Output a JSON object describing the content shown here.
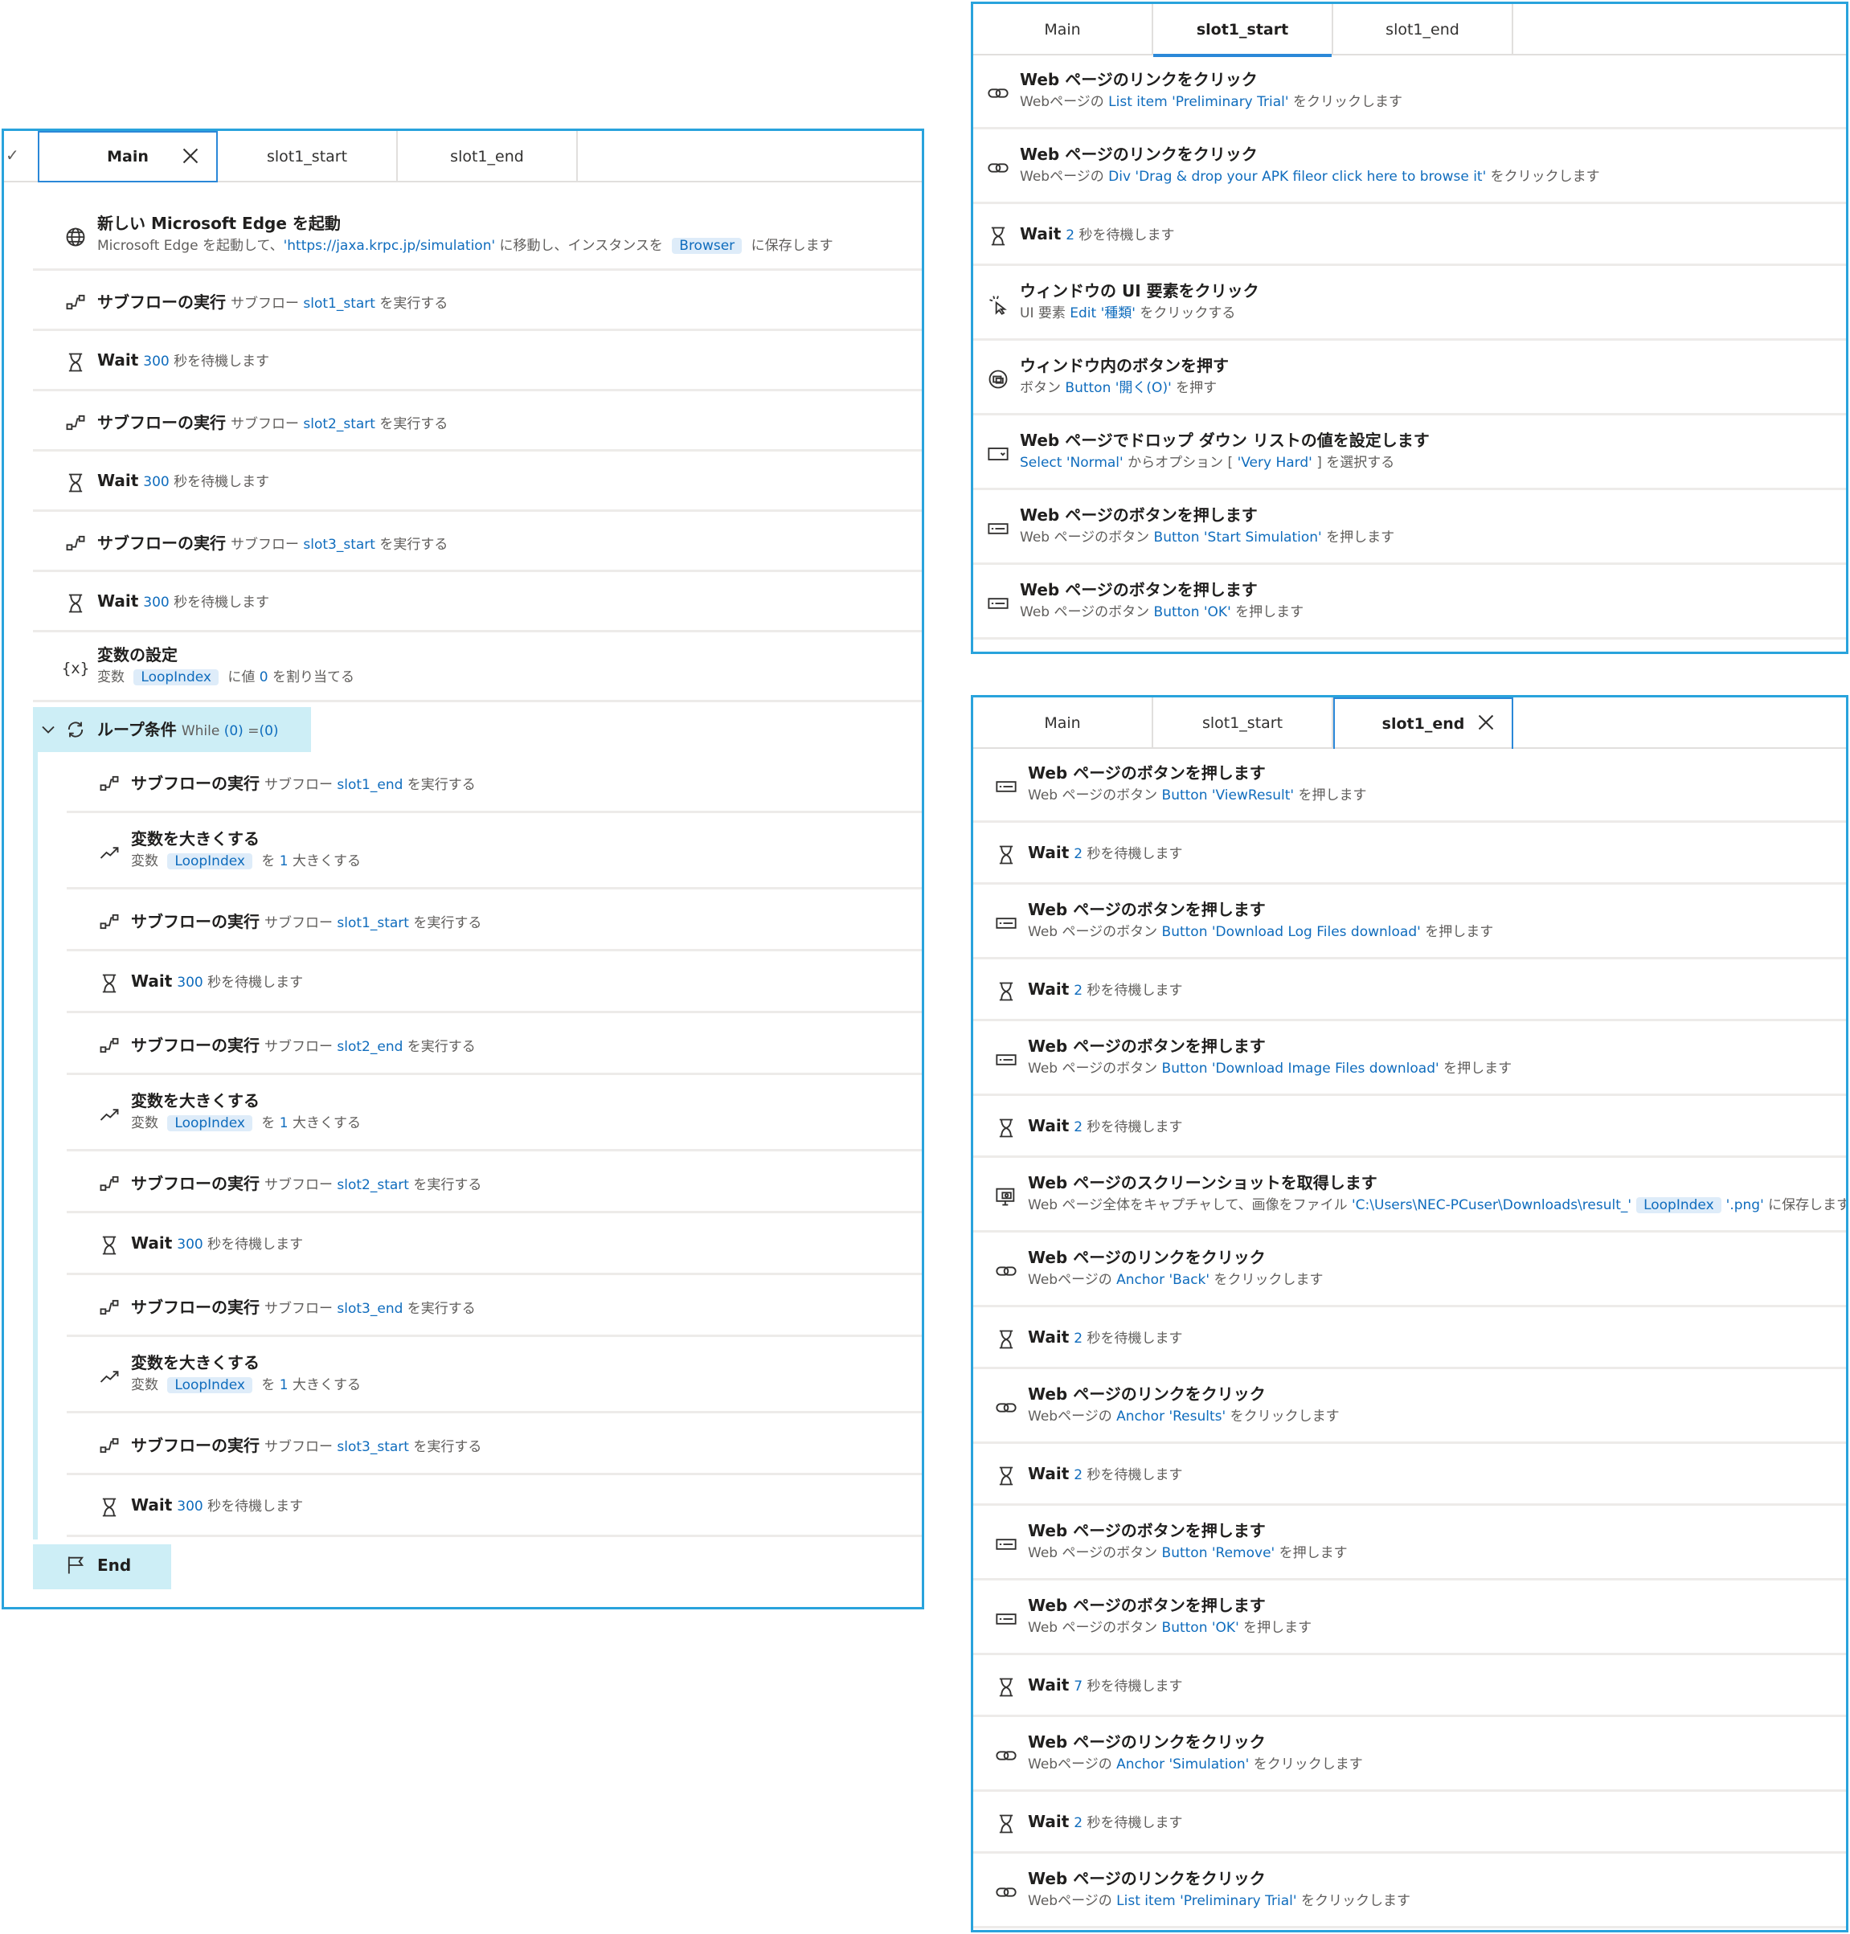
{
  "main_panel": {
    "tabs": [
      {
        "label": "Main"
      },
      {
        "label": "slot1_start"
      },
      {
        "label": "slot1_end"
      }
    ],
    "steps": [
      {
        "icon": "globe-icon",
        "title": "新しい Microsoft Edge を起動",
        "line2": [
          {
            "t": "Microsoft Edge を起動して、"
          },
          {
            "v": "'https://jaxa.krpc.jp/simulation'"
          },
          {
            "t": " に移動し、インスタンスを "
          },
          {
            "c": "Browser"
          },
          {
            "t": " に保存します"
          }
        ]
      },
      {
        "icon": "subflow-icon",
        "title": "サブフローの実行",
        "desc": [
          {
            "t": "サブフロー "
          },
          {
            "v": "slot1_start"
          },
          {
            "t": " を実行する"
          }
        ]
      },
      {
        "icon": "hourglass-icon",
        "title": "Wait",
        "desc": [
          {
            "v": "300"
          },
          {
            "t": " 秒を待機します"
          }
        ]
      },
      {
        "icon": "subflow-icon",
        "title": "サブフローの実行",
        "desc": [
          {
            "t": "サブフロー "
          },
          {
            "v": "slot2_start"
          },
          {
            "t": " を実行する"
          }
        ]
      },
      {
        "icon": "hourglass-icon",
        "title": "Wait",
        "desc": [
          {
            "v": "300"
          },
          {
            "t": " 秒を待機します"
          }
        ]
      },
      {
        "icon": "subflow-icon",
        "title": "サブフローの実行",
        "desc": [
          {
            "t": "サブフロー "
          },
          {
            "v": "slot3_start"
          },
          {
            "t": " を実行する"
          }
        ]
      },
      {
        "icon": "hourglass-icon",
        "title": "Wait",
        "desc": [
          {
            "v": "300"
          },
          {
            "t": " 秒を待機します"
          }
        ]
      },
      {
        "icon": "variable-icon",
        "title": "変数の設定",
        "line2": [
          {
            "t": "変数 "
          },
          {
            "c": "LoopIndex"
          },
          {
            "t": " に値 "
          },
          {
            "v": "0"
          },
          {
            "t": " を割り当てる"
          }
        ]
      }
    ],
    "loop": {
      "title": "ループ条件",
      "desc": [
        {
          "t": "While "
        },
        {
          "v": "(0)"
        },
        {
          "t": " ="
        },
        {
          "v": "(0)"
        }
      ]
    },
    "loop_steps": [
      {
        "icon": "subflow-icon",
        "title": "サブフローの実行",
        "desc": [
          {
            "t": "サブフロー "
          },
          {
            "v": "slot1_end"
          },
          {
            "t": " を実行する"
          }
        ]
      },
      {
        "icon": "increase-icon",
        "title": "変数を大きくする",
        "line2": [
          {
            "t": "変数 "
          },
          {
            "c": "LoopIndex"
          },
          {
            "t": " を "
          },
          {
            "v": "1"
          },
          {
            "t": " 大きくする"
          }
        ]
      },
      {
        "icon": "subflow-icon",
        "title": "サブフローの実行",
        "desc": [
          {
            "t": "サブフロー "
          },
          {
            "v": "slot1_start"
          },
          {
            "t": " を実行する"
          }
        ]
      },
      {
        "icon": "hourglass-icon",
        "title": "Wait",
        "desc": [
          {
            "v": "300"
          },
          {
            "t": " 秒を待機します"
          }
        ]
      },
      {
        "icon": "subflow-icon",
        "title": "サブフローの実行",
        "desc": [
          {
            "t": "サブフロー "
          },
          {
            "v": "slot2_end"
          },
          {
            "t": " を実行する"
          }
        ]
      },
      {
        "icon": "increase-icon",
        "title": "変数を大きくする",
        "line2": [
          {
            "t": "変数 "
          },
          {
            "c": "LoopIndex"
          },
          {
            "t": " を "
          },
          {
            "v": "1"
          },
          {
            "t": " 大きくする"
          }
        ]
      },
      {
        "icon": "subflow-icon",
        "title": "サブフローの実行",
        "desc": [
          {
            "t": "サブフロー "
          },
          {
            "v": "slot2_start"
          },
          {
            "t": " を実行する"
          }
        ]
      },
      {
        "icon": "hourglass-icon",
        "title": "Wait",
        "desc": [
          {
            "v": "300"
          },
          {
            "t": " 秒を待機します"
          }
        ]
      },
      {
        "icon": "subflow-icon",
        "title": "サブフローの実行",
        "desc": [
          {
            "t": "サブフロー "
          },
          {
            "v": "slot3_end"
          },
          {
            "t": " を実行する"
          }
        ]
      },
      {
        "icon": "increase-icon",
        "title": "変数を大きくする",
        "line2": [
          {
            "t": "変数 "
          },
          {
            "c": "LoopIndex"
          },
          {
            "t": " を "
          },
          {
            "v": "1"
          },
          {
            "t": " 大きくする"
          }
        ]
      },
      {
        "icon": "subflow-icon",
        "title": "サブフローの実行",
        "desc": [
          {
            "t": "サブフロー "
          },
          {
            "v": "slot3_start"
          },
          {
            "t": " を実行する"
          }
        ]
      },
      {
        "icon": "hourglass-icon",
        "title": "Wait",
        "desc": [
          {
            "v": "300"
          },
          {
            "t": " 秒を待機します"
          }
        ]
      }
    ],
    "end_label": "End"
  },
  "start_panel": {
    "tabs": [
      {
        "label": "Main"
      },
      {
        "label": "slot1_start"
      },
      {
        "label": "slot1_end"
      }
    ],
    "steps": [
      {
        "icon": "link-icon",
        "title": "Web ページのリンクをクリック",
        "line2": [
          {
            "t": "Webページの "
          },
          {
            "v": "List item 'Preliminary Trial'"
          },
          {
            "t": " をクリックします"
          }
        ]
      },
      {
        "icon": "link-icon",
        "title": "Web ページのリンクをクリック",
        "line2": [
          {
            "t": "Webページの "
          },
          {
            "v": "Div 'Drag & drop your APK fileor click here to browse it'"
          },
          {
            "t": " をクリックします"
          }
        ]
      },
      {
        "icon": "hourglass-icon",
        "title": "Wait",
        "desc": [
          {
            "v": "2"
          },
          {
            "t": " 秒を待機します"
          }
        ]
      },
      {
        "icon": "ui-click-icon",
        "title": "ウィンドウの UI 要素をクリック",
        "line2": [
          {
            "t": "UI 要素 "
          },
          {
            "v": "Edit '種類'"
          },
          {
            "t": " をクリックする"
          }
        ]
      },
      {
        "icon": "window-button-icon",
        "title": "ウィンドウ内のボタンを押す",
        "line2": [
          {
            "t": "ボタン "
          },
          {
            "v": "Button '開く(O)'"
          },
          {
            "t": " を押す"
          }
        ]
      },
      {
        "icon": "dropdown-icon",
        "title": "Web ページでドロップ ダウン リストの値を設定します",
        "line2": [
          {
            "v": "Select 'Normal'"
          },
          {
            "t": " からオプション [ "
          },
          {
            "v": "'Very Hard'"
          },
          {
            "t": " ] を選択する"
          }
        ]
      },
      {
        "icon": "web-button-icon",
        "title": "Web ページのボタンを押します",
        "line2": [
          {
            "t": "Web ページのボタン "
          },
          {
            "v": "Button 'Start Simulation'"
          },
          {
            "t": " を押します"
          }
        ]
      },
      {
        "icon": "web-button-icon",
        "title": "Web ページのボタンを押します",
        "line2": [
          {
            "t": "Web ページのボタン "
          },
          {
            "v": "Button 'OK'"
          },
          {
            "t": " を押します"
          }
        ]
      }
    ]
  },
  "end_panel": {
    "tabs": [
      {
        "label": "Main"
      },
      {
        "label": "slot1_start"
      },
      {
        "label": "slot1_end"
      }
    ],
    "steps": [
      {
        "icon": "web-button-icon",
        "title": "Web ページのボタンを押します",
        "line2": [
          {
            "t": "Web ページのボタン "
          },
          {
            "v": "Button 'ViewResult'"
          },
          {
            "t": " を押します"
          }
        ]
      },
      {
        "icon": "hourglass-icon",
        "title": "Wait",
        "desc": [
          {
            "v": "2"
          },
          {
            "t": " 秒を待機します"
          }
        ]
      },
      {
        "icon": "web-button-icon",
        "title": "Web ページのボタンを押します",
        "line2": [
          {
            "t": "Web ページのボタン "
          },
          {
            "v": "Button 'Download Log Files download'"
          },
          {
            "t": " を押します"
          }
        ]
      },
      {
        "icon": "hourglass-icon",
        "title": "Wait",
        "desc": [
          {
            "v": "2"
          },
          {
            "t": " 秒を待機します"
          }
        ]
      },
      {
        "icon": "web-button-icon",
        "title": "Web ページのボタンを押します",
        "line2": [
          {
            "t": "Web ページのボタン "
          },
          {
            "v": "Button 'Download Image Files download'"
          },
          {
            "t": " を押します"
          }
        ]
      },
      {
        "icon": "hourglass-icon",
        "title": "Wait",
        "desc": [
          {
            "v": "2"
          },
          {
            "t": " 秒を待機します"
          }
        ]
      },
      {
        "icon": "screenshot-icon",
        "title": "Web ページのスクリーンショットを取得します",
        "line2": [
          {
            "t": "Web ページ全体をキャプチャして、画像をファイル "
          },
          {
            "v": "'C:\\Users\\NEC-PCuser\\Downloads\\result_'"
          },
          {
            "c": "LoopIndex"
          },
          {
            "v": "'.png'"
          },
          {
            "t": " に保存します"
          }
        ]
      },
      {
        "icon": "link-icon",
        "title": "Web ページのリンクをクリック",
        "line2": [
          {
            "t": "Webページの "
          },
          {
            "v": "Anchor 'Back'"
          },
          {
            "t": " をクリックします"
          }
        ]
      },
      {
        "icon": "hourglass-icon",
        "title": "Wait",
        "desc": [
          {
            "v": "2"
          },
          {
            "t": " 秒を待機します"
          }
        ]
      },
      {
        "icon": "link-icon",
        "title": "Web ページのリンクをクリック",
        "line2": [
          {
            "t": "Webページの "
          },
          {
            "v": "Anchor 'Results'"
          },
          {
            "t": " をクリックします"
          }
        ]
      },
      {
        "icon": "hourglass-icon",
        "title": "Wait",
        "desc": [
          {
            "v": "2"
          },
          {
            "t": " 秒を待機します"
          }
        ]
      },
      {
        "icon": "web-button-icon",
        "title": "Web ページのボタンを押します",
        "line2": [
          {
            "t": "Web ページのボタン "
          },
          {
            "v": "Button 'Remove'"
          },
          {
            "t": " を押します"
          }
        ]
      },
      {
        "icon": "web-button-icon",
        "title": "Web ページのボタンを押します",
        "line2": [
          {
            "t": "Web ページのボタン "
          },
          {
            "v": "Button 'OK'"
          },
          {
            "t": " を押します"
          }
        ]
      },
      {
        "icon": "hourglass-icon",
        "title": "Wait",
        "desc": [
          {
            "v": "7"
          },
          {
            "t": " 秒を待機します"
          }
        ]
      },
      {
        "icon": "link-icon",
        "title": "Web ページのリンクをクリック",
        "line2": [
          {
            "t": "Webページの "
          },
          {
            "v": "Anchor 'Simulation'"
          },
          {
            "t": " をクリックします"
          }
        ]
      },
      {
        "icon": "hourglass-icon",
        "title": "Wait",
        "desc": [
          {
            "v": "2"
          },
          {
            "t": " 秒を待機します"
          }
        ]
      },
      {
        "icon": "link-icon",
        "title": "Web ページのリンクをクリック",
        "line2": [
          {
            "t": "Webページの "
          },
          {
            "v": "List item 'Preliminary Trial'"
          },
          {
            "t": " をクリックします"
          }
        ]
      }
    ]
  }
}
